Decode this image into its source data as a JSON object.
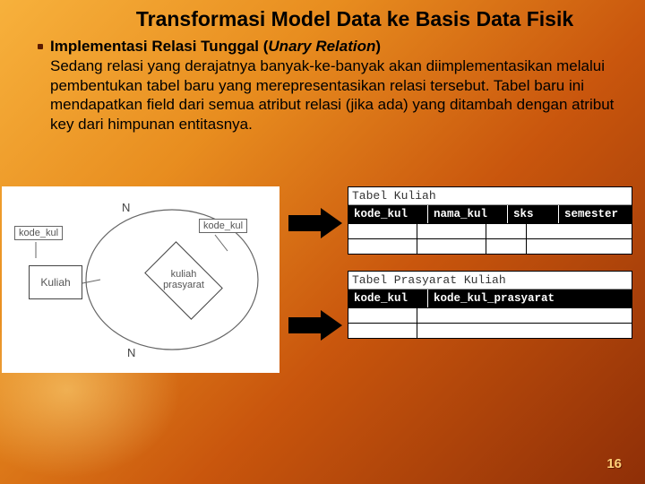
{
  "title": "Transformasi Model Data ke Basis Data Fisik",
  "bullet": {
    "heading_prefix": "Implementasi Relasi Tunggal (",
    "heading_italic": "Unary Relation",
    "heading_suffix": ")",
    "body": "Sedang relasi yang derajatnya banyak-ke-banyak akan diimplementasikan melalui pembentukan tabel baru yang merepresentasikan relasi tersebut. Tabel baru ini mendapatkan field dari semua atribut relasi (jika ada) yang ditambah dengan atribut key dari himpunan entitasnya."
  },
  "erd": {
    "key_left": "kode_kul",
    "key_right": "kode_kul",
    "entity": "Kuliah",
    "relation_line1": "kuliah",
    "relation_line2": "prasyarat",
    "cardinality": "N"
  },
  "tables": [
    {
      "caption": "Tabel Kuliah",
      "columns": [
        "kode_kul",
        "nama_kul",
        "sks",
        "semester"
      ],
      "widths": [
        76,
        76,
        44,
        0
      ]
    },
    {
      "caption": "Tabel Prasyarat Kuliah",
      "columns": [
        "kode_kul",
        "kode_kul_prasyarat"
      ],
      "widths": [
        76,
        0
      ]
    }
  ],
  "page_number": "16"
}
